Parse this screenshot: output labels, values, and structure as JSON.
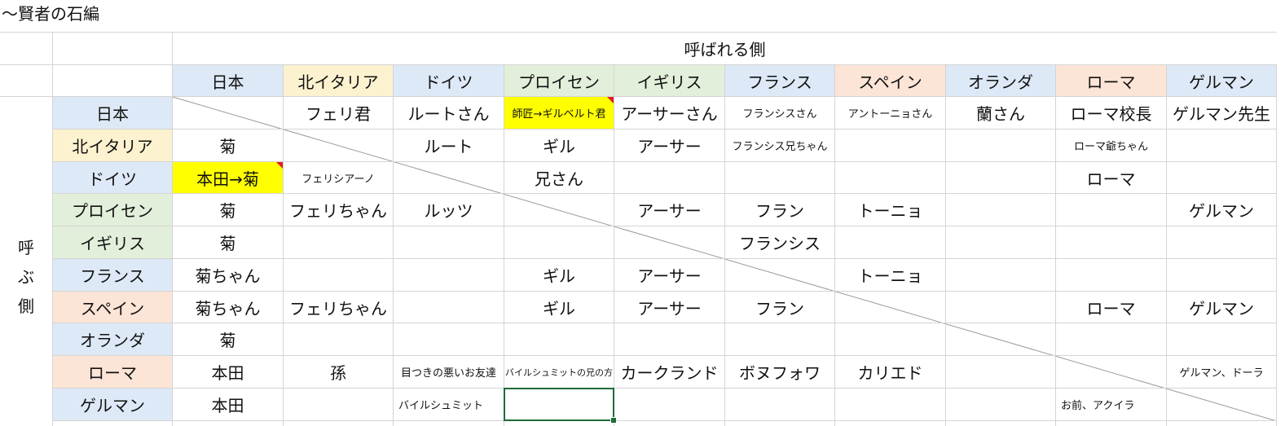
{
  "sheet_title": "～賢者の石編",
  "header_top": "呼ばれる側",
  "side_label": [
    "呼",
    "ぶ",
    "側"
  ],
  "colors": {
    "blue": "#dde9f6",
    "yellow": "#fdf2d0",
    "green": "#e2efda",
    "peach": "#fce4d6",
    "highlight": "#ffff00",
    "grid": "#d4d4d4",
    "select": "#1e6b3a"
  },
  "columns": [
    {
      "label": "日本",
      "color": "blue"
    },
    {
      "label": "北イタリア",
      "color": "yellow"
    },
    {
      "label": "ドイツ",
      "color": "blue"
    },
    {
      "label": "プロイセン",
      "color": "green"
    },
    {
      "label": "イギリス",
      "color": "green"
    },
    {
      "label": "フランス",
      "color": "blue"
    },
    {
      "label": "スペイン",
      "color": "peach"
    },
    {
      "label": "オランダ",
      "color": "blue"
    },
    {
      "label": "ローマ",
      "color": "peach"
    },
    {
      "label": "ゲルマン",
      "color": "blue"
    }
  ],
  "rows": [
    {
      "label": "日本",
      "color": "blue",
      "cells": [
        "",
        "フェリ君",
        "ルートさん",
        {
          "text": "師匠→ギルベルト君",
          "size": "sm",
          "highlight": true,
          "comment": true
        },
        "アーサーさん",
        {
          "text": "フランシスさん",
          "size": "sm"
        },
        {
          "text": "アントーニョさん",
          "size": "sm"
        },
        "蘭さん",
        "ローマ校長",
        "ゲルマン先生"
      ]
    },
    {
      "label": "北イタリア",
      "color": "yellow",
      "cells": [
        "菊",
        "",
        "ルート",
        "ギル",
        "アーサー",
        {
          "text": "フランシス兄ちゃん",
          "size": "sm"
        },
        "",
        "",
        {
          "text": "ローマ爺ちゃん",
          "size": "sm"
        },
        ""
      ]
    },
    {
      "label": "ドイツ",
      "color": "blue",
      "cells": [
        {
          "text": "本田→菊",
          "highlight": true,
          "comment": true
        },
        {
          "text": "フェリシアーノ",
          "size": "sm"
        },
        "",
        "兄さん",
        "",
        "",
        "",
        "",
        "ローマ",
        ""
      ]
    },
    {
      "label": "プロイセン",
      "color": "green",
      "cells": [
        "菊",
        "フェリちゃん",
        "ルッツ",
        "",
        "アーサー",
        "フラン",
        "トーニョ",
        "",
        "",
        "ゲルマン"
      ]
    },
    {
      "label": "イギリス",
      "color": "green",
      "cells": [
        "菊",
        "",
        "",
        "",
        "",
        "フランシス",
        "",
        "",
        "",
        ""
      ]
    },
    {
      "label": "フランス",
      "color": "blue",
      "cells": [
        "菊ちゃん",
        "",
        "",
        "ギル",
        "アーサー",
        "",
        "トーニョ",
        "",
        "",
        ""
      ]
    },
    {
      "label": "スペイン",
      "color": "peach",
      "cells": [
        "菊ちゃん",
        "フェリちゃん",
        "",
        "ギル",
        "アーサー",
        "フラン",
        "",
        "",
        "ローマ",
        "ゲルマン"
      ]
    },
    {
      "label": "オランダ",
      "color": "blue",
      "cells": [
        "菊",
        "",
        "",
        "",
        "",
        "",
        "",
        "",
        "",
        ""
      ]
    },
    {
      "label": "ローマ",
      "color": "peach",
      "cells": [
        "本田",
        "孫",
        {
          "text": "目つきの悪いお友達",
          "size": "sm"
        },
        {
          "text": "バイルシュミットの兄の方",
          "size": "xs"
        },
        "カークランド",
        "ボヌフォワ",
        "カリエド",
        "",
        "",
        {
          "text": "ゲルマン、ドーラ",
          "size": "sm"
        }
      ]
    },
    {
      "label": "ゲルマン",
      "color": "blue",
      "cells": [
        "本田",
        "",
        {
          "text": "バイルシュミット",
          "size": "sm",
          "align": "left"
        },
        {
          "text": "",
          "selected": true
        },
        "",
        "",
        "",
        "",
        {
          "text": "お前、アクイラ",
          "size": "sm",
          "align": "left"
        },
        ""
      ]
    }
  ]
}
